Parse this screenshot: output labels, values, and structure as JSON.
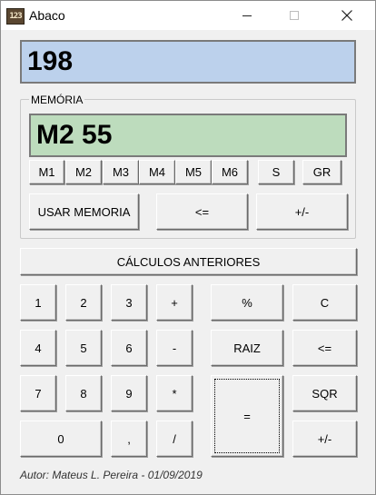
{
  "window": {
    "title": "Abaco",
    "icon_text": "123"
  },
  "main_display": {
    "value": "198"
  },
  "memory": {
    "label": "MEMÓRIA",
    "display_value": "M2 55",
    "slots": [
      "M1",
      "M2",
      "M3",
      "M4",
      "M5",
      "M6"
    ],
    "save_label": "S",
    "record_label": "GR",
    "use_label": "USAR MEMORIA",
    "backspace_label": "<=",
    "sign_label": "+/-"
  },
  "history_label": "CÁLCULOS ANTERIORES",
  "keypad": {
    "k1": "1",
    "k2": "2",
    "k3": "3",
    "k4": "4",
    "k5": "5",
    "k6": "6",
    "k7": "7",
    "k8": "8",
    "k9": "9",
    "k0": "0",
    "comma": ",",
    "plus": "+",
    "minus": "-",
    "multiply": "*",
    "divide": "/",
    "percent": "%",
    "clear": "C",
    "root": "RAIZ",
    "backspace": "<=",
    "square": "SQR",
    "equals": "=",
    "sign": "+/-"
  },
  "credit": "Autor: Mateus L. Pereira - 01/09/2019"
}
